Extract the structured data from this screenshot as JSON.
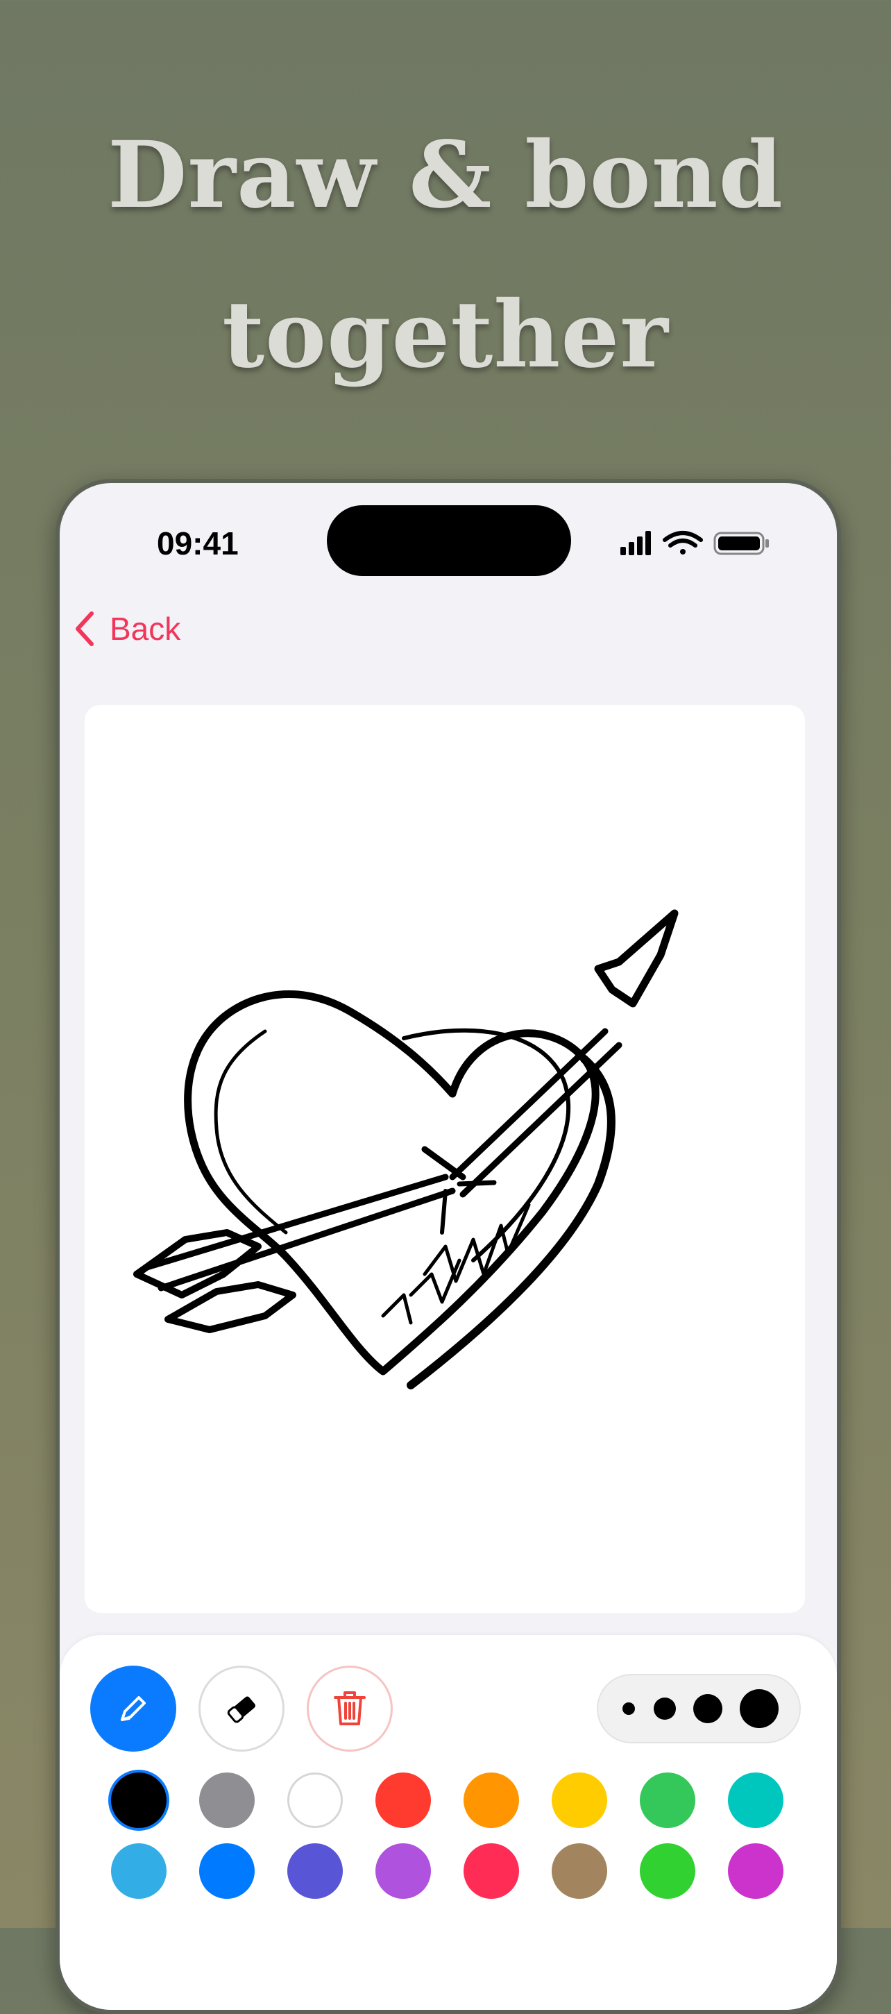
{
  "headline": {
    "line1": "Draw & bond",
    "line2": "together"
  },
  "status_bar": {
    "time": "09:41",
    "icons": [
      "signal-icon",
      "wifi-icon",
      "battery-icon"
    ]
  },
  "nav": {
    "back_label": "Back",
    "accent_color": "#f2355a"
  },
  "canvas": {
    "drawing": "heart-with-arrow"
  },
  "toolbar": {
    "tools": [
      {
        "name": "pencil-icon",
        "active": true,
        "color": "#0a7bff"
      },
      {
        "name": "eraser-icon",
        "active": false
      },
      {
        "name": "trash-icon",
        "active": false,
        "color": "#f0443a"
      }
    ],
    "brush_sizes": [
      "small",
      "medium",
      "large",
      "x-large"
    ],
    "colors_row1": [
      "#000000",
      "#8e8e93",
      "#ffffff",
      "#ff3b30",
      "#ff9500",
      "#ffcc00",
      "#34c759",
      "#00c7be"
    ],
    "colors_row2": [
      "#32ade6",
      "#007aff",
      "#5856d6",
      "#af52de",
      "#ff2d55",
      "#a2845e",
      "#30d130",
      "#cc33cc"
    ],
    "selected_color": "#000000"
  }
}
